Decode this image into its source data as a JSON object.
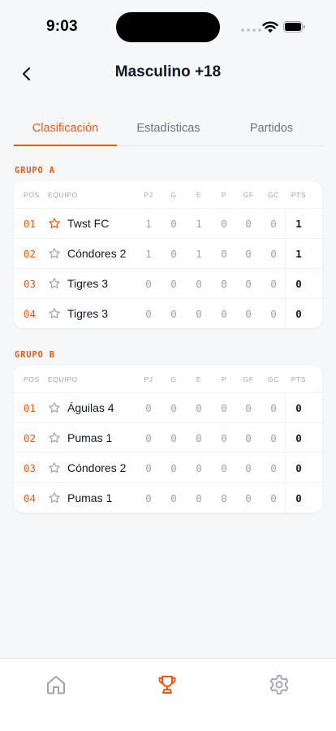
{
  "status": {
    "time": "9:03"
  },
  "header": {
    "title": "Masculino +18"
  },
  "tabs": [
    {
      "label": "Clasificación",
      "active": true
    },
    {
      "label": "Estadísticas",
      "active": false
    },
    {
      "label": "Partidos",
      "active": false
    }
  ],
  "columns": {
    "pos": "POS",
    "team": "EQUIPO",
    "pj": "PJ",
    "g": "G",
    "e": "E",
    "p": "P",
    "gf": "GF",
    "gc": "GC",
    "pts": "PTS"
  },
  "groups": [
    {
      "label": "GRUPO A",
      "rows": [
        {
          "pos": "01",
          "team": "Twst FC",
          "favorite": true,
          "pj": "1",
          "g": "0",
          "e": "1",
          "p": "0",
          "gf": "0",
          "gc": "0",
          "pts": "1"
        },
        {
          "pos": "02",
          "team": "Cóndores 2",
          "favorite": false,
          "pj": "1",
          "g": "0",
          "e": "1",
          "p": "0",
          "gf": "0",
          "gc": "0",
          "pts": "1"
        },
        {
          "pos": "03",
          "team": "Tigres 3",
          "favorite": false,
          "pj": "0",
          "g": "0",
          "e": "0",
          "p": "0",
          "gf": "0",
          "gc": "0",
          "pts": "0"
        },
        {
          "pos": "04",
          "team": "Tigres 3",
          "favorite": false,
          "pj": "0",
          "g": "0",
          "e": "0",
          "p": "0",
          "gf": "0",
          "gc": "0",
          "pts": "0"
        }
      ]
    },
    {
      "label": "GRUPO B",
      "rows": [
        {
          "pos": "01",
          "team": "Águilas 4",
          "favorite": false,
          "pj": "0",
          "g": "0",
          "e": "0",
          "p": "0",
          "gf": "0",
          "gc": "0",
          "pts": "0"
        },
        {
          "pos": "02",
          "team": "Pumas 1",
          "favorite": false,
          "pj": "0",
          "g": "0",
          "e": "0",
          "p": "0",
          "gf": "0",
          "gc": "0",
          "pts": "0"
        },
        {
          "pos": "03",
          "team": "Cóndores 2",
          "favorite": false,
          "pj": "0",
          "g": "0",
          "e": "0",
          "p": "0",
          "gf": "0",
          "gc": "0",
          "pts": "0"
        },
        {
          "pos": "04",
          "team": "Pumas 1",
          "favorite": false,
          "pj": "0",
          "g": "0",
          "e": "0",
          "p": "0",
          "gf": "0",
          "gc": "0",
          "pts": "0"
        }
      ]
    }
  ],
  "bottom_nav": [
    {
      "icon": "home-icon",
      "active": false
    },
    {
      "icon": "trophy-icon",
      "active": true
    },
    {
      "icon": "gear-icon",
      "active": false
    }
  ],
  "colors": {
    "accent": "#ea580c",
    "muted": "#9ca3af",
    "text": "#111827",
    "background": "#f6f7f9"
  }
}
